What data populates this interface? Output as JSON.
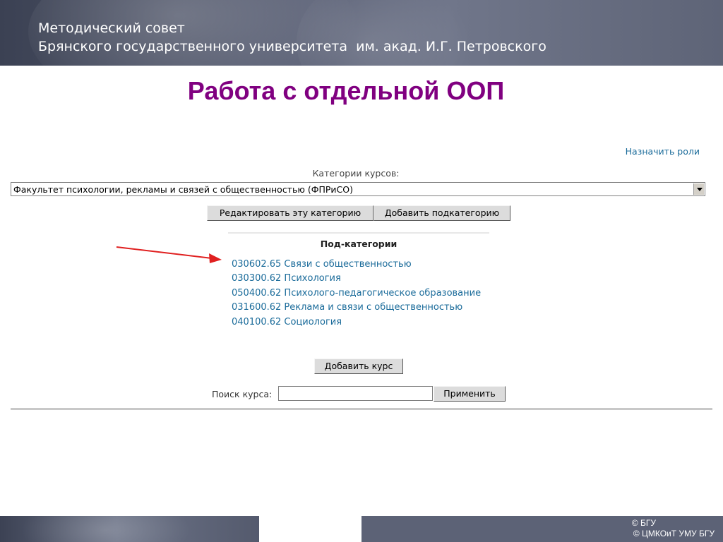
{
  "header": {
    "line1": "Методический совет",
    "line2": "Брянского государственного университета  им. акад. И.Г. Петровского"
  },
  "slide_title": "Работа с отдельной ООП",
  "assign_roles_link": "Назначить роли",
  "category_label": "Категории курсов:",
  "category_select": {
    "selected": "Факультет психологии, рекламы и связей с общественностью (ФПРиСО)"
  },
  "buttons": {
    "edit_category": "Редактировать эту категорию",
    "add_subcategory": "Добавить подкатегорию",
    "add_course": "Добавить курс",
    "apply": "Применить"
  },
  "subcategories": {
    "title": "Под-категории",
    "items": [
      "030602.65 Связи с общественностью",
      "030300.62 Психология",
      "050400.62 Психолого-педагогическое образование",
      "031600.62 Реклама и связи с общественностью",
      "040100.62 Социология"
    ]
  },
  "search": {
    "label": "Поиск курса:",
    "value": ""
  },
  "footer": {
    "copyright1": "© БГУ",
    "copyright2": "© ЦМКОиТ УМУ БГУ"
  },
  "colors": {
    "title": "#800080",
    "link": "#1a6b9a",
    "annotation_arrow": "#e02020",
    "banner": "#5a6075"
  }
}
